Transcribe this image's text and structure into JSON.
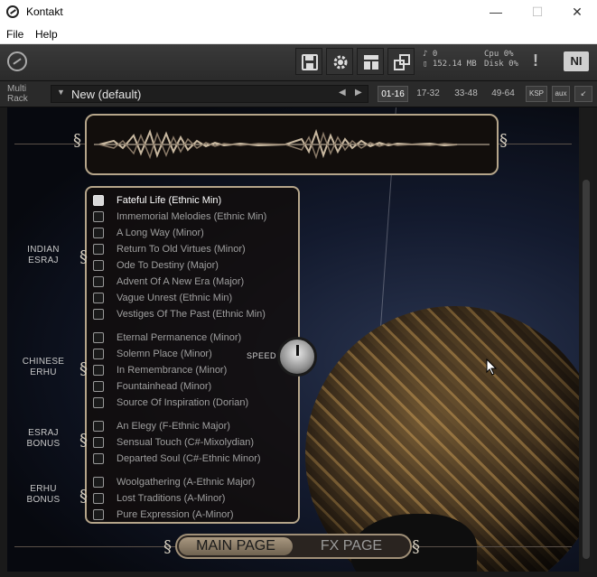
{
  "window": {
    "title": "Kontakt",
    "minimize": "—",
    "maximize": "☐",
    "close": "✕"
  },
  "menu": [
    "File",
    "Help"
  ],
  "toolbar": {
    "midi_icon": "♪",
    "midi_value": "0",
    "memory_value": "152.14 MB",
    "cpu_label": "Cpu",
    "cpu_value": "0%",
    "disk_label": "Disk",
    "disk_value": "0%",
    "warning": "!",
    "ni_label": "NI"
  },
  "rack": {
    "label_line1": "Multi",
    "label_line2": "Rack",
    "preset_arrow": "▼",
    "preset_name": "New (default)",
    "prev": "◀",
    "next": "▶",
    "pages": [
      "01-16",
      "17-32",
      "33-48",
      "49-64"
    ],
    "active_page": "01-16",
    "ksp": "KSP",
    "aux": "aux",
    "collapse": "↙"
  },
  "instrument": {
    "speed_label": "SPEED",
    "groups": [
      {
        "label": "INDIAN\nESRAJ",
        "items": [
          {
            "label": "Fateful Life (Ethnic Min)",
            "selected": true
          },
          {
            "label": "Immemorial Melodies (Ethnic Min)",
            "selected": false
          },
          {
            "label": "A Long Way (Minor)",
            "selected": false
          },
          {
            "label": "Return To Old Virtues (Minor)",
            "selected": false
          },
          {
            "label": "Ode To Destiny (Major)",
            "selected": false
          },
          {
            "label": "Advent Of A New Era (Major)",
            "selected": false
          },
          {
            "label": "Vague Unrest (Ethnic Min)",
            "selected": false
          },
          {
            "label": "Vestiges Of The Past (Ethnic Min)",
            "selected": false
          }
        ]
      },
      {
        "label": "CHINESE\nERHU",
        "items": [
          {
            "label": "Eternal Permanence (Minor)",
            "selected": false
          },
          {
            "label": "Solemn Place (Minor)",
            "selected": false
          },
          {
            "label": "In Remembrance (Minor)",
            "selected": false
          },
          {
            "label": "Fountainhead (Minor)",
            "selected": false
          },
          {
            "label": "Source Of Inspiration (Dorian)",
            "selected": false
          }
        ]
      },
      {
        "label": "ESRAJ\nBONUS",
        "items": [
          {
            "label": "An Elegy (F-Ethnic Major)",
            "selected": false
          },
          {
            "label": "Sensual Touch (C#-Mixolydian)",
            "selected": false
          },
          {
            "label": "Departed Soul (C#-Ethnic Minor)",
            "selected": false
          }
        ]
      },
      {
        "label": "ERHU\nBONUS",
        "items": [
          {
            "label": "Woolgathering (A-Ethnic Major)",
            "selected": false
          },
          {
            "label": "Lost Traditions (A-Minor)",
            "selected": false
          },
          {
            "label": "Pure Expression (A-Minor)",
            "selected": false
          }
        ]
      }
    ],
    "tabs": {
      "main": "MAIN PAGE",
      "fx": "FX PAGE"
    }
  }
}
